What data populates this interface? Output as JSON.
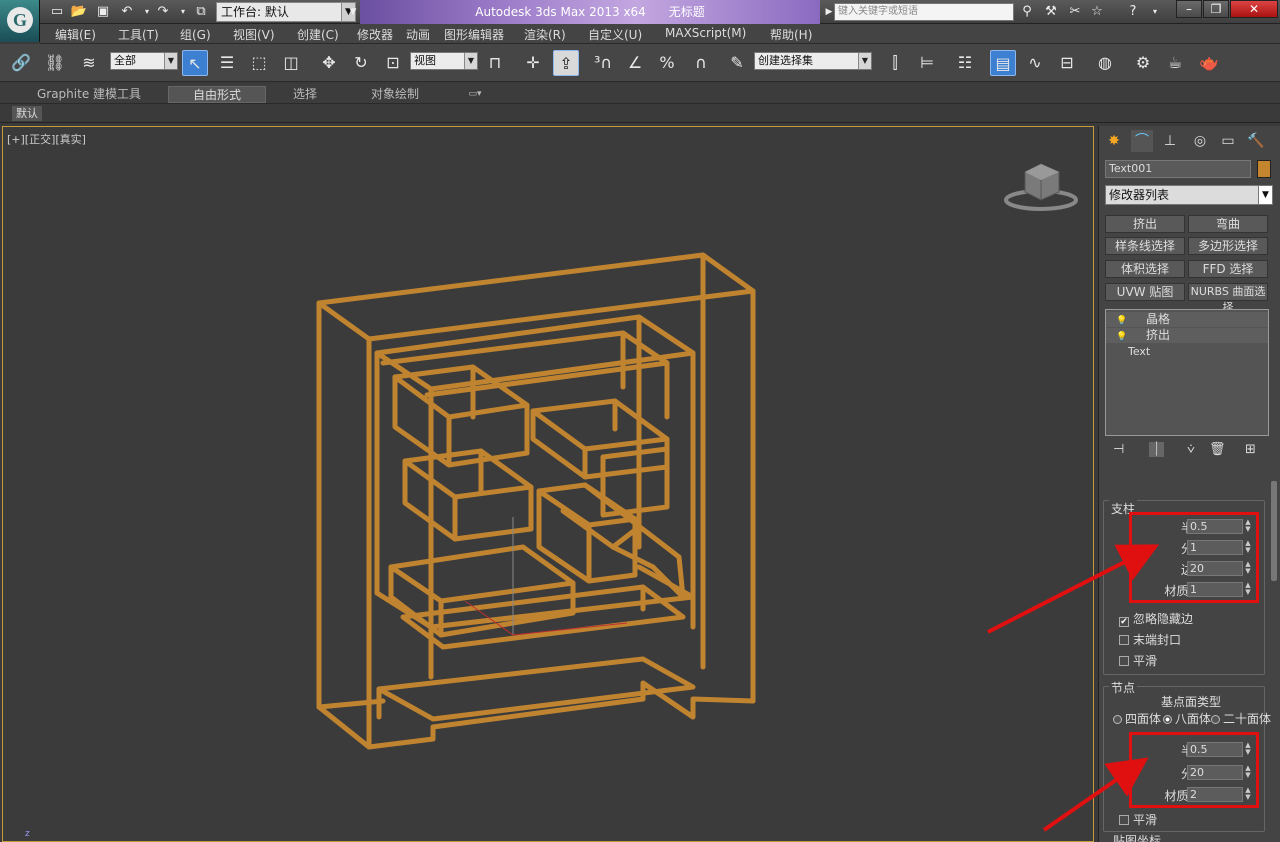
{
  "titlebar": {
    "workspace": "工作台: 默认",
    "app_title": "Autodesk 3ds Max  2013 x64",
    "file_title": "无标题",
    "search_placeholder": "键入关键字或短语"
  },
  "menu": [
    "编辑(E)",
    "工具(T)",
    "组(G)",
    "视图(V)",
    "创建(C)",
    "修改器",
    "动画",
    "图形编辑器",
    "渲染(R)",
    "自定义(U)",
    "MAXScript(M)",
    "帮助(H)"
  ],
  "toolbar": {
    "filter": "全部",
    "coord": "视图",
    "selection_set": "创建选择集"
  },
  "ribbon": {
    "tabs": [
      "Graphite 建模工具",
      "自由形式",
      "选择",
      "对象绘制"
    ],
    "default_label": "默认"
  },
  "viewport": {
    "label": "[+][正交][真实]",
    "axis_label": "z"
  },
  "panel": {
    "object_name": "Text001",
    "object_color": "#c3862e",
    "modifier_list": "修改器列表",
    "modifier_buttons": [
      "挤出",
      "弯曲",
      "样条线选择",
      "多边形选择",
      "体积选择",
      "FFD 选择",
      "UVW 贴图",
      "NURBS 曲面选择"
    ],
    "stack": [
      "晶格",
      "挤出",
      "Text"
    ],
    "struts": {
      "title": "支柱",
      "radius_label": "半径:",
      "radius": "0.5",
      "segments_label": "分段:",
      "segments": "1",
      "sides_label": "边数:",
      "sides": "20",
      "matid_label": "材质 ID:",
      "matid": "1",
      "ignore_hidden": "忽略隐藏边",
      "end_caps": "末端封口",
      "smooth": "平滑"
    },
    "joints": {
      "title": "节点",
      "geodesic_label": "基点面类型",
      "radio_tetra": "四面体",
      "radio_octa": "八面体",
      "radio_icosa": "二十面体",
      "radius_label": "半径:",
      "radius": "0.5",
      "segments_label": "分段:",
      "segments": "20",
      "matid_label": "材质 ID:",
      "matid": "2",
      "smooth": "平滑"
    },
    "mapping_title": "贴图坐标"
  }
}
